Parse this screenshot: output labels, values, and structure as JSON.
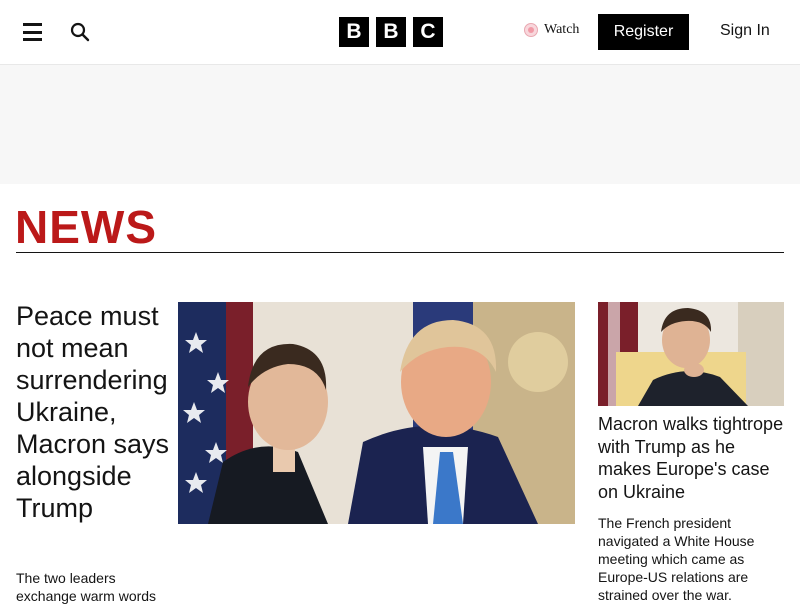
{
  "header": {
    "logo_letters": [
      "B",
      "B",
      "C"
    ],
    "watch_label": "Watch",
    "register_label": "Register",
    "signin_label": "Sign In",
    "icons": [
      "menu-icon",
      "search-icon",
      "watch-icon"
    ]
  },
  "section": {
    "title": "NEWS",
    "accent_color": "#bb1919"
  },
  "lead_story": {
    "headline": "Peace must not mean surrendering Ukraine, Macron says alongside Trump",
    "summary": "The two leaders exchange warm words"
  },
  "side_story": {
    "headline": "Macron walks tightrope with Trump as he makes Europe's case on Ukraine",
    "summary": "The French president navigated a White House meeting which came as Europe-US relations are strained over the war."
  }
}
